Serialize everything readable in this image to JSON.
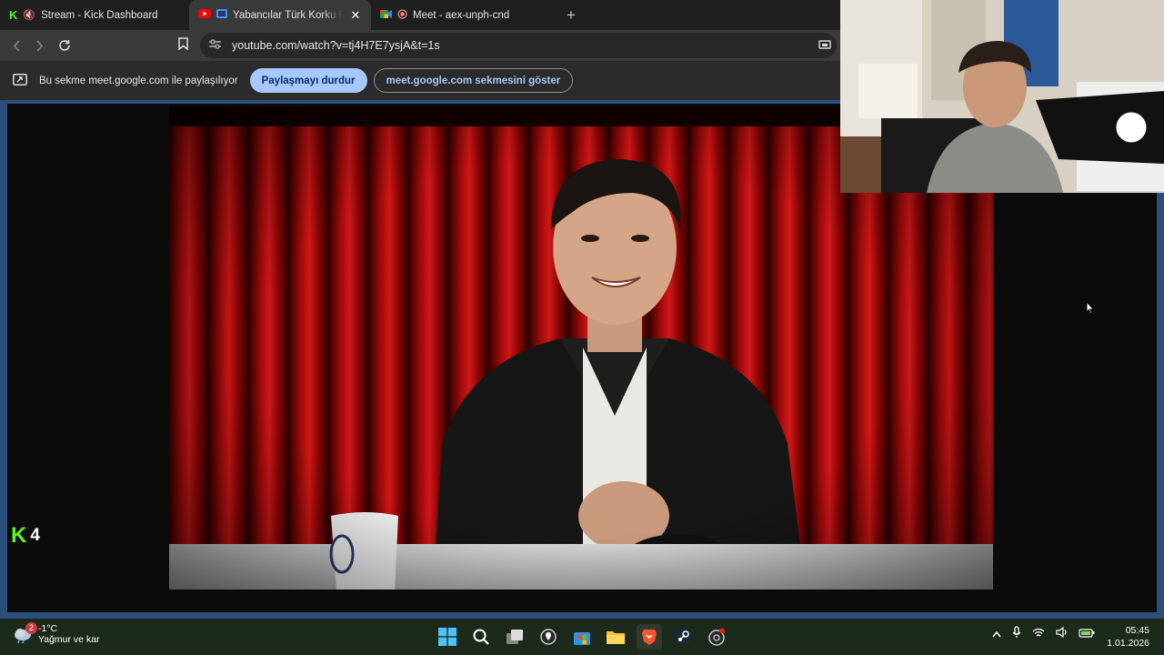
{
  "browser": {
    "tabs": [
      {
        "label": "Stream - Kick Dashboard",
        "icon": "kick-logo-icon",
        "muted": true
      },
      {
        "label": "Yabancılar Türk Korku Filmleri",
        "icon": "youtube-icon",
        "active": true
      },
      {
        "label": "Meet - aex-unph-cnd",
        "icon": "meet-icon",
        "recording": true
      }
    ],
    "close_tab": "✕",
    "new_tab": "+",
    "url": "youtube.com/watch?v=tj4H7E7ysjA&t=1s"
  },
  "sharebar": {
    "message": "Bu sekme meet.google.com ile paylaşılıyor",
    "stop_label": "Paylaşmayı durdur",
    "show_label": "meet.google.com sekmesini göster"
  },
  "overlay": {
    "viewer_count": "4"
  },
  "taskbar": {
    "weather_temp": "-1°C",
    "weather_desc": "Yağmur ve kar",
    "weather_badge": "2",
    "time": "05:45",
    "date": "1.01.2026"
  },
  "colors": {
    "accent_blue": "#a8c7fa",
    "kick_green": "#53fc18",
    "frame_blue": "#2c4e7a"
  }
}
